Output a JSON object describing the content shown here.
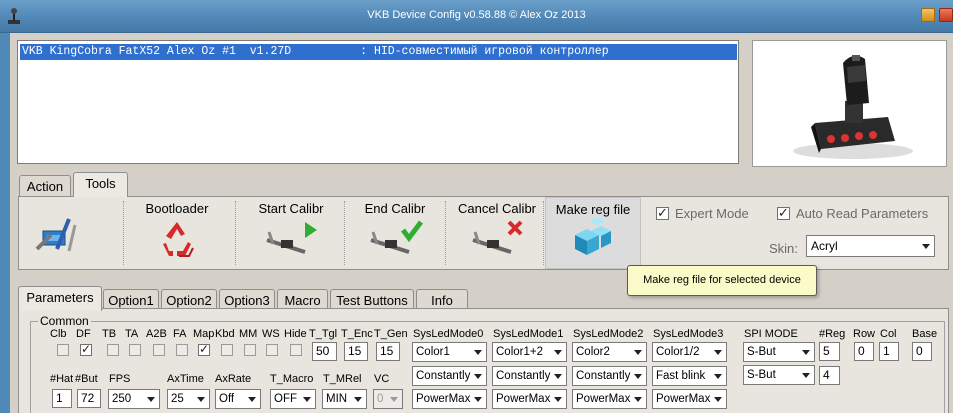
{
  "window": {
    "title": "VKB Device Config v0.58.88 © Alex Oz 2013"
  },
  "device_list": {
    "selected_row": "VKB KingCobra FatX52 Alex Oz #1  v1.27D          : HID-совместимый игровой контроллер"
  },
  "main_tabs": [
    {
      "label": "Action"
    },
    {
      "label": "Tools"
    }
  ],
  "tools": {
    "bootloader": "Bootloader",
    "start_calibr": "Start Calibr",
    "end_calibr": "End Calibr",
    "cancel_calibr": "Cancel Calibr",
    "make_reg_file": "Make reg file"
  },
  "options": {
    "expert_mode": {
      "label": "Expert Mode",
      "checked": true
    },
    "auto_read": {
      "label": "Auto Read Parameters",
      "checked": true
    },
    "skin_label": "Skin:",
    "skin_value": "Acryl"
  },
  "tooltip": "Make reg file for selected device",
  "param_tabs": [
    {
      "label": "Parameters"
    },
    {
      "label": "Option1"
    },
    {
      "label": "Option2"
    },
    {
      "label": "Option3"
    },
    {
      "label": "Macro"
    },
    {
      "label": "Test Buttons"
    },
    {
      "label": "Info"
    }
  ],
  "common": {
    "label": "Common",
    "headers_row1": [
      "Clb",
      "DF",
      "TB",
      "TA",
      "A2B",
      "FA",
      "Map",
      "Kbd",
      "MM",
      "WS",
      "Hide",
      "T_Tgl",
      "T_Enc",
      "T_Gen",
      "SysLedMode0",
      "SysLedMode1",
      "SysLedMode2",
      "SysLedMode3",
      "SPI MODE",
      "#Reg",
      "Row",
      "Col",
      "Base"
    ],
    "checkboxes": {
      "Clb": false,
      "DF": true,
      "TB": false,
      "TA": false,
      "A2B": false,
      "FA": false,
      "Map": true,
      "Kbd": false,
      "MM": false,
      "WS": false,
      "Hide": false
    },
    "t_tgl": "50",
    "t_enc": "15",
    "t_gen": "15",
    "sysled0": [
      "Color1",
      "Constantly",
      "PowerMax"
    ],
    "sysled1": [
      "Color1+2",
      "Constantly",
      "PowerMax"
    ],
    "sysled2": [
      "Color2",
      "Constantly",
      "PowerMax"
    ],
    "sysled3": [
      "Color1/2",
      "Fast blink",
      "PowerMax"
    ],
    "spi_mode": [
      "S-But",
      "S-But"
    ],
    "reg": [
      "5",
      "4"
    ],
    "row": "0",
    "col": "1",
    "base": "0",
    "headers_row2": [
      "#Hat",
      "#But",
      "FPS",
      "AxTime",
      "AxRate",
      "T_Macro",
      "T_MRel",
      "VC"
    ],
    "hat": "1",
    "but": "72",
    "fps": "250",
    "axtime": "25",
    "axrate": "Off",
    "t_macro": "OFF",
    "t_mrel": "MIN",
    "vc": "0"
  }
}
